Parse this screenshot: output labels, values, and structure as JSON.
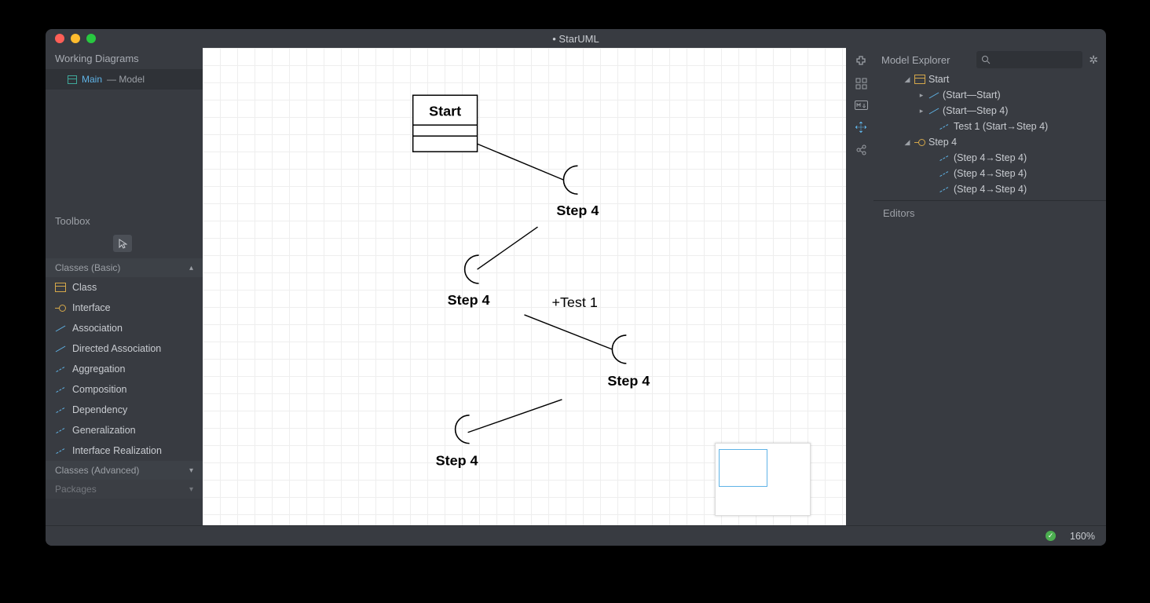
{
  "window": {
    "title": "• StarUML"
  },
  "leftPanel": {
    "title": "Working Diagrams",
    "diagram": {
      "main": "Main",
      "sub": "— Model"
    }
  },
  "toolbox": {
    "title": "Toolbox",
    "categories": [
      {
        "label": "Classes (Basic)",
        "expanded": true
      },
      {
        "label": "Classes (Advanced)",
        "expanded": false
      },
      {
        "label": "Packages",
        "expanded": false
      }
    ],
    "tools": [
      {
        "label": "Class",
        "icon": "class"
      },
      {
        "label": "Interface",
        "icon": "interface"
      },
      {
        "label": "Association",
        "icon": "assoc"
      },
      {
        "label": "Directed Association",
        "icon": "assoc"
      },
      {
        "label": "Aggregation",
        "icon": "dep"
      },
      {
        "label": "Composition",
        "icon": "dep"
      },
      {
        "label": "Dependency",
        "icon": "dep"
      },
      {
        "label": "Generalization",
        "icon": "dep"
      },
      {
        "label": "Interface Realization",
        "icon": "dep"
      }
    ]
  },
  "canvas": {
    "classBox": {
      "label": "Start"
    },
    "interfaces": [
      {
        "label": "Step 4"
      },
      {
        "label": "Step 4"
      },
      {
        "label": "Step 4"
      },
      {
        "label": "Step 4"
      }
    ],
    "assocLabel": "+Test 1"
  },
  "rightPanel": {
    "title": "Model Explorer",
    "tree": {
      "n0": "Start",
      "n1": "(Start—Start)",
      "n2": "(Start—Step 4)",
      "n3": "Test 1 (Start→Step 4)",
      "n4": "Step 4",
      "n5": "(Step 4→Step 4)",
      "n6": "(Step 4→Step 4)",
      "n7": "(Step 4→Step 4)"
    },
    "editors": "Editors"
  },
  "statusbar": {
    "zoom": "160%"
  }
}
